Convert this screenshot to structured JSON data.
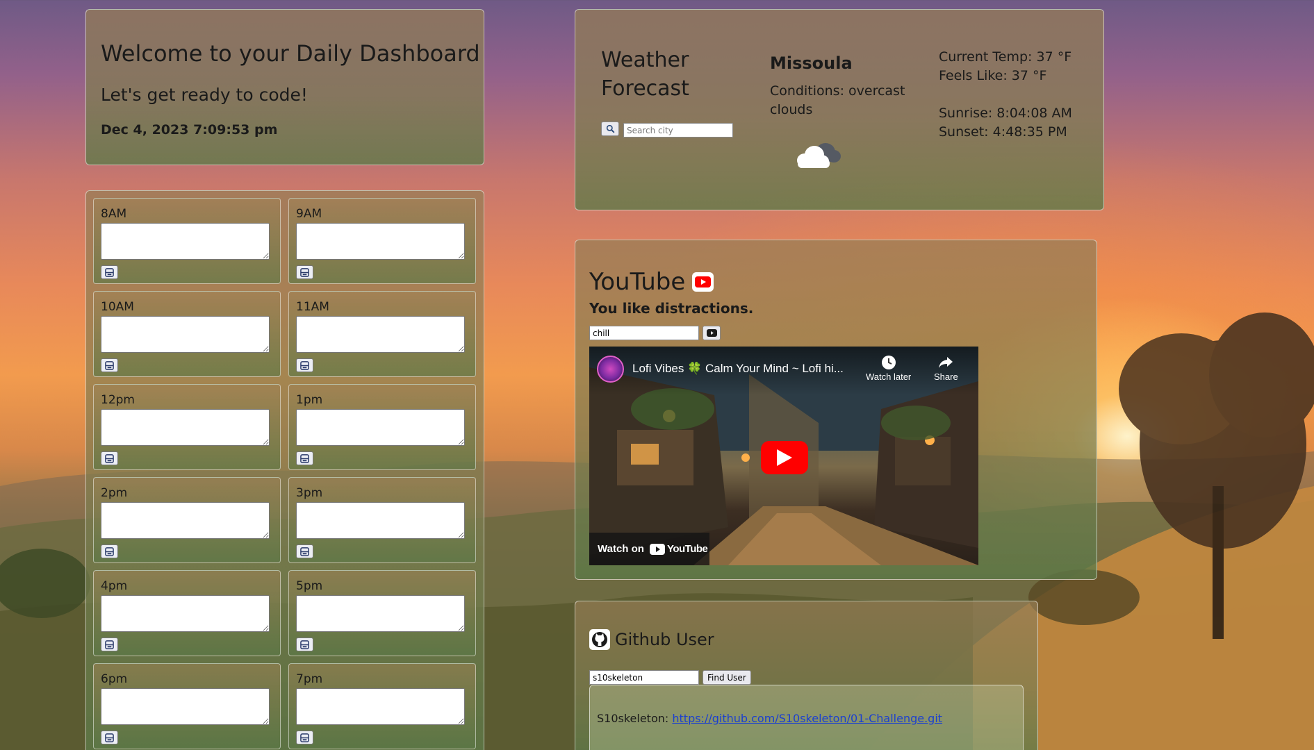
{
  "header": {
    "title": "Welcome to your Daily Dashboard",
    "subtitle": "Let's get ready to code!",
    "datetime": "Dec 4, 2023 7:09:53 pm"
  },
  "planner": {
    "slots": [
      {
        "label": "8AM"
      },
      {
        "label": "9AM"
      },
      {
        "label": "10AM"
      },
      {
        "label": "11AM"
      },
      {
        "label": "12pm"
      },
      {
        "label": "1pm"
      },
      {
        "label": "2pm"
      },
      {
        "label": "3pm"
      },
      {
        "label": "4pm"
      },
      {
        "label": "5pm"
      },
      {
        "label": "6pm"
      },
      {
        "label": "7pm"
      }
    ],
    "save_icon": "save-icon"
  },
  "weather": {
    "title": "Weather Forecast",
    "search_placeholder": "Search city",
    "search_icon": "search-icon",
    "city": "Missoula",
    "conditions": "Conditions: overcast clouds",
    "condition_icon": "cloud-icon",
    "current_temp": "Current Temp: 37 °F",
    "feels_like": "Feels Like: 37 °F",
    "sunrise": "Sunrise: 8:04:08 AM",
    "sunset": "Sunset: 4:48:35 PM"
  },
  "youtube": {
    "title": "YouTube",
    "subtitle": "You like distractions.",
    "search_value": "chill",
    "video": {
      "title": "Lofi Vibes 🍀 Calm Your Mind ~ Lofi hi...",
      "watch_later": "Watch later",
      "share": "Share",
      "watch_on": "Watch on",
      "brand": "YouTube"
    },
    "accent_color": "#ff0000"
  },
  "github": {
    "title": "Github User",
    "search_value": "s10skeleton",
    "find_button": "Find User",
    "result_user": "S10skeleton:",
    "result_link": "https://github.com/S10skeleton/01-Challenge.git"
  }
}
